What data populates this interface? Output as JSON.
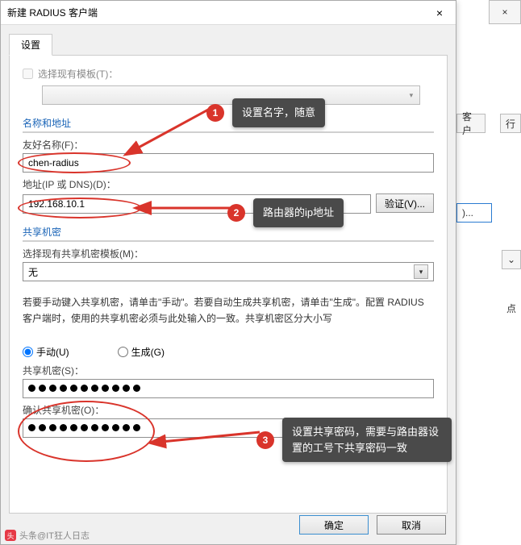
{
  "dialog": {
    "title": "新建 RADIUS 客户端",
    "close_icon": "×",
    "tab_label": "设置",
    "enable_template_label": "选择现有模板(T)：",
    "section_name_addr": "名称和地址",
    "friendly_name_label": "友好名称(F)：",
    "friendly_name_value": "chen-radius",
    "address_label": "地址(IP 或 DNS)(D)：",
    "address_value": "192.168.10.1",
    "verify_label": "验证(V)...",
    "section_shared": "共享机密",
    "shared_template_label": "选择现有共享机密模板(M)：",
    "shared_template_value": "无",
    "note_text": "若要手动键入共享机密，请单击\"手动\"。若要自动生成共享机密，请单击\"生成\"。配置 RADIUS 客户端时，使用的共享机密必须与此处输入的一致。共享机密区分大小写",
    "radio_manual": "手动(U)",
    "radio_generate": "生成(G)",
    "shared_secret_label": "共享机密(S)：",
    "confirm_secret_label": "确认共享机密(O)：",
    "ok_label": "确定",
    "cancel_label": "取消"
  },
  "annotations": {
    "a1": "设置名字，随意",
    "a2": "路由器的ip地址",
    "a3": "设置共享密码，需要与路由器设置的工号下共享密码一致"
  },
  "background": {
    "frag_client": "客户",
    "frag_row": "行",
    "frag_dot": ")...",
    "frag_dian": "点"
  },
  "footer": "头条@IT狂人日志"
}
